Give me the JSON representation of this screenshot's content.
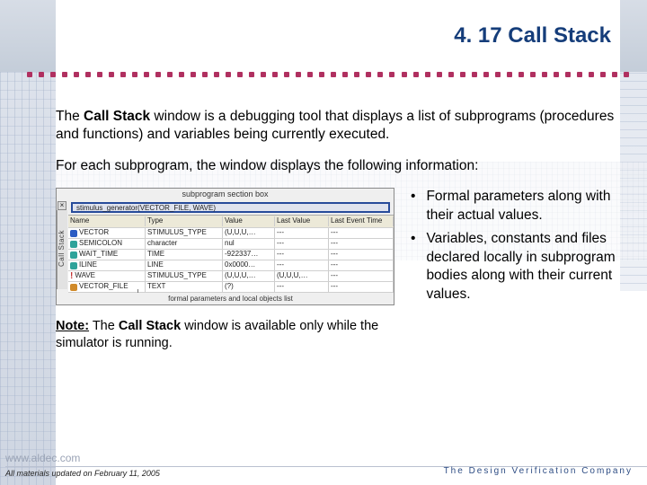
{
  "title": "4. 17  Call Stack",
  "intro": {
    "pre": "The ",
    "bold": "Call Stack",
    "post": " window is a debugging tool that displays a list of subprograms (procedures and functions) and variables being currently executed."
  },
  "lead": "For each subprogram, the window displays the following information:",
  "bullets": [
    "Formal parameters along with their actual values.",
    "Variables, constants and files declared locally in subprogram bodies along with their current values."
  ],
  "note": {
    "label": "Note:",
    "pre": " The ",
    "bold": "Call Stack",
    "post": " window is available only while the simulator is running."
  },
  "callstack": {
    "top_callout": "subprogram section box",
    "bottom_callout": "formal parameters and local objects list",
    "tab_label": "Call Stack",
    "subprogram": "stimulus_generator(VECTOR_FILE, WAVE)",
    "headers": [
      "Name",
      "Type",
      "Value",
      "Last Value",
      "Last Event Time"
    ],
    "rows": [
      {
        "icon": "blue",
        "name": "VECTOR",
        "type": "STIMULUS_TYPE",
        "value": "(U,U,U,…",
        "last": "---",
        "time": "---"
      },
      {
        "icon": "teal",
        "name": "SEMICOLON",
        "type": "character",
        "value": "nul",
        "last": "---",
        "time": "---"
      },
      {
        "icon": "teal",
        "name": "WAIT_TIME",
        "type": "TIME",
        "value": "-922337…",
        "last": "---",
        "time": "---"
      },
      {
        "icon": "teal",
        "name": "ILINE",
        "type": "LINE",
        "value": "0x0000…",
        "last": "---",
        "time": "---"
      },
      {
        "icon": "red",
        "name": "WAVE",
        "type": "STIMULUS_TYPE",
        "value": "(U,U,U,…",
        "last": "(U,U,U,…",
        "time": "---"
      },
      {
        "icon": "orng",
        "name": "VECTOR_FILE",
        "type": "TEXT",
        "value": "(?)",
        "last": "---",
        "time": "---"
      }
    ]
  },
  "footer": {
    "url": "www.aldec.com",
    "updated": "All materials updated on  February 11, 2005",
    "tagline": "The Design Verification Company"
  }
}
